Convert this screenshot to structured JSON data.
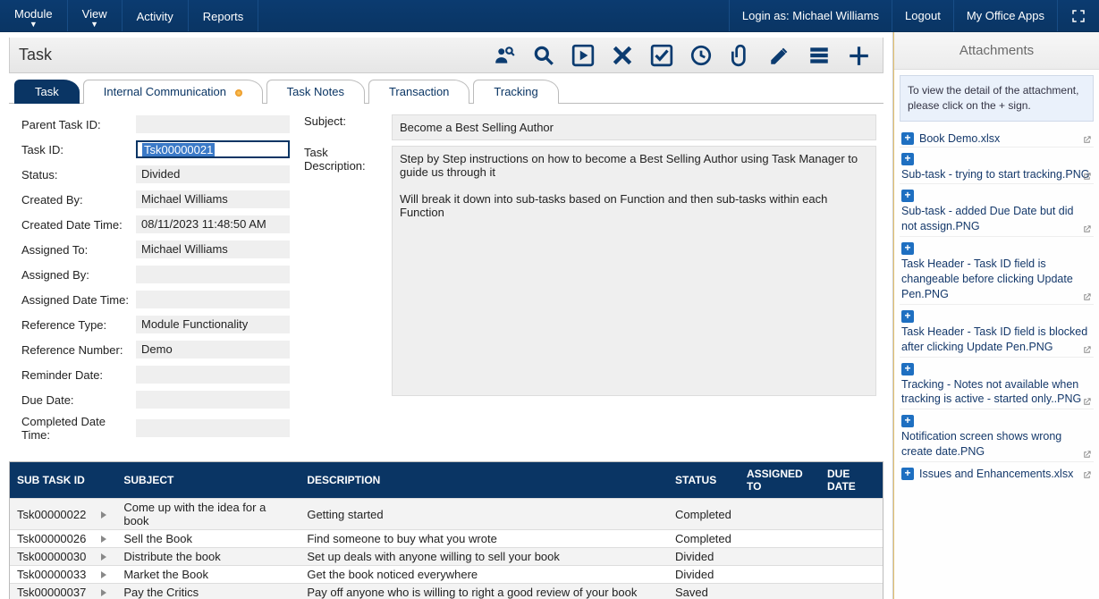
{
  "topnav": {
    "left": [
      "Module",
      "View",
      "Activity",
      "Reports"
    ],
    "login_label": "Login as: Michael Williams",
    "logout": "Logout",
    "office_apps": "My Office Apps"
  },
  "page_title": "Task",
  "tabs": [
    {
      "label": "Task",
      "active": true
    },
    {
      "label": "Internal Communication",
      "dot": true
    },
    {
      "label": "Task Notes"
    },
    {
      "label": "Transaction"
    },
    {
      "label": "Tracking"
    }
  ],
  "form_left": {
    "parentTaskId": {
      "label": "Parent Task ID:",
      "value": ""
    },
    "taskId": {
      "label": "Task ID:",
      "value": "Tsk00000021",
      "highlight": true
    },
    "status": {
      "label": "Status:",
      "value": "Divided"
    },
    "createdBy": {
      "label": "Created By:",
      "value": "Michael Williams"
    },
    "createdDt": {
      "label": "Created Date Time:",
      "value": "08/11/2023 11:48:50 AM"
    },
    "assignedTo": {
      "label": "Assigned To:",
      "value": "Michael Williams"
    },
    "assignedBy": {
      "label": "Assigned By:",
      "value": ""
    },
    "assignedDt": {
      "label": "Assigned Date Time:",
      "value": ""
    },
    "refType": {
      "label": "Reference Type:",
      "value": "Module Functionality"
    },
    "refNum": {
      "label": "Reference Number:",
      "value": "Demo"
    },
    "reminder": {
      "label": "Reminder Date:",
      "value": ""
    },
    "due": {
      "label": "Due Date:",
      "value": ""
    },
    "completed": {
      "label": "Completed Date Time:",
      "value": ""
    }
  },
  "form_right": {
    "subject_label": "Subject:",
    "subject_value": "Become a Best Selling Author",
    "desc_label": "Task Description:",
    "desc_value": "Step by Step instructions on how to become a Best Selling Author using Task Manager to guide us through it\n\nWill break it down into sub-tasks based on Function and then sub-tasks within each Function"
  },
  "subtask": {
    "columns": [
      "SUB TASK ID",
      "",
      "SUBJECT",
      "DESCRIPTION",
      "STATUS",
      "ASSIGNED TO",
      "DUE DATE"
    ],
    "rows": [
      {
        "id": "Tsk00000022",
        "subject": "Come up with the idea for a book",
        "desc": "Getting started",
        "status": "Completed",
        "assigned": "",
        "due": ""
      },
      {
        "id": "Tsk00000026",
        "subject": "Sell the Book",
        "desc": "Find someone to buy what you wrote",
        "status": "Completed",
        "assigned": "",
        "due": ""
      },
      {
        "id": "Tsk00000030",
        "subject": "Distribute the book",
        "desc": "Set up deals with anyone willing to sell your book",
        "status": "Divided",
        "assigned": "",
        "due": ""
      },
      {
        "id": "Tsk00000033",
        "subject": "Market the Book",
        "desc": "Get the book noticed everywhere",
        "status": "Divided",
        "assigned": "",
        "due": ""
      },
      {
        "id": "Tsk00000037",
        "subject": "Pay the Critics",
        "desc": "Pay off anyone who is willing to right a good review of your book",
        "status": "Saved",
        "assigned": "",
        "due": ""
      }
    ]
  },
  "attachments": {
    "header": "Attachments",
    "hint": "To view the detail of the attachment, please click on the + sign.",
    "items": [
      {
        "name": "Book Demo.xlsx",
        "sub": ""
      },
      {
        "name": "",
        "sub": "Sub-task - trying to start tracking.PNG"
      },
      {
        "name": "",
        "sub": "Sub-task - added Due Date but did not assign.PNG"
      },
      {
        "name": "",
        "sub": "Task Header - Task ID field is changeable before clicking Update Pen.PNG"
      },
      {
        "name": "",
        "sub": "Task Header - Task ID field is blocked after clicking Update Pen.PNG"
      },
      {
        "name": "",
        "sub": "Tracking - Notes not available when tracking is active - started only..PNG"
      },
      {
        "name": "",
        "sub": "Notification screen shows wrong create date.PNG"
      },
      {
        "name": "Issues and Enhancements.xlsx",
        "sub": ""
      }
    ]
  }
}
